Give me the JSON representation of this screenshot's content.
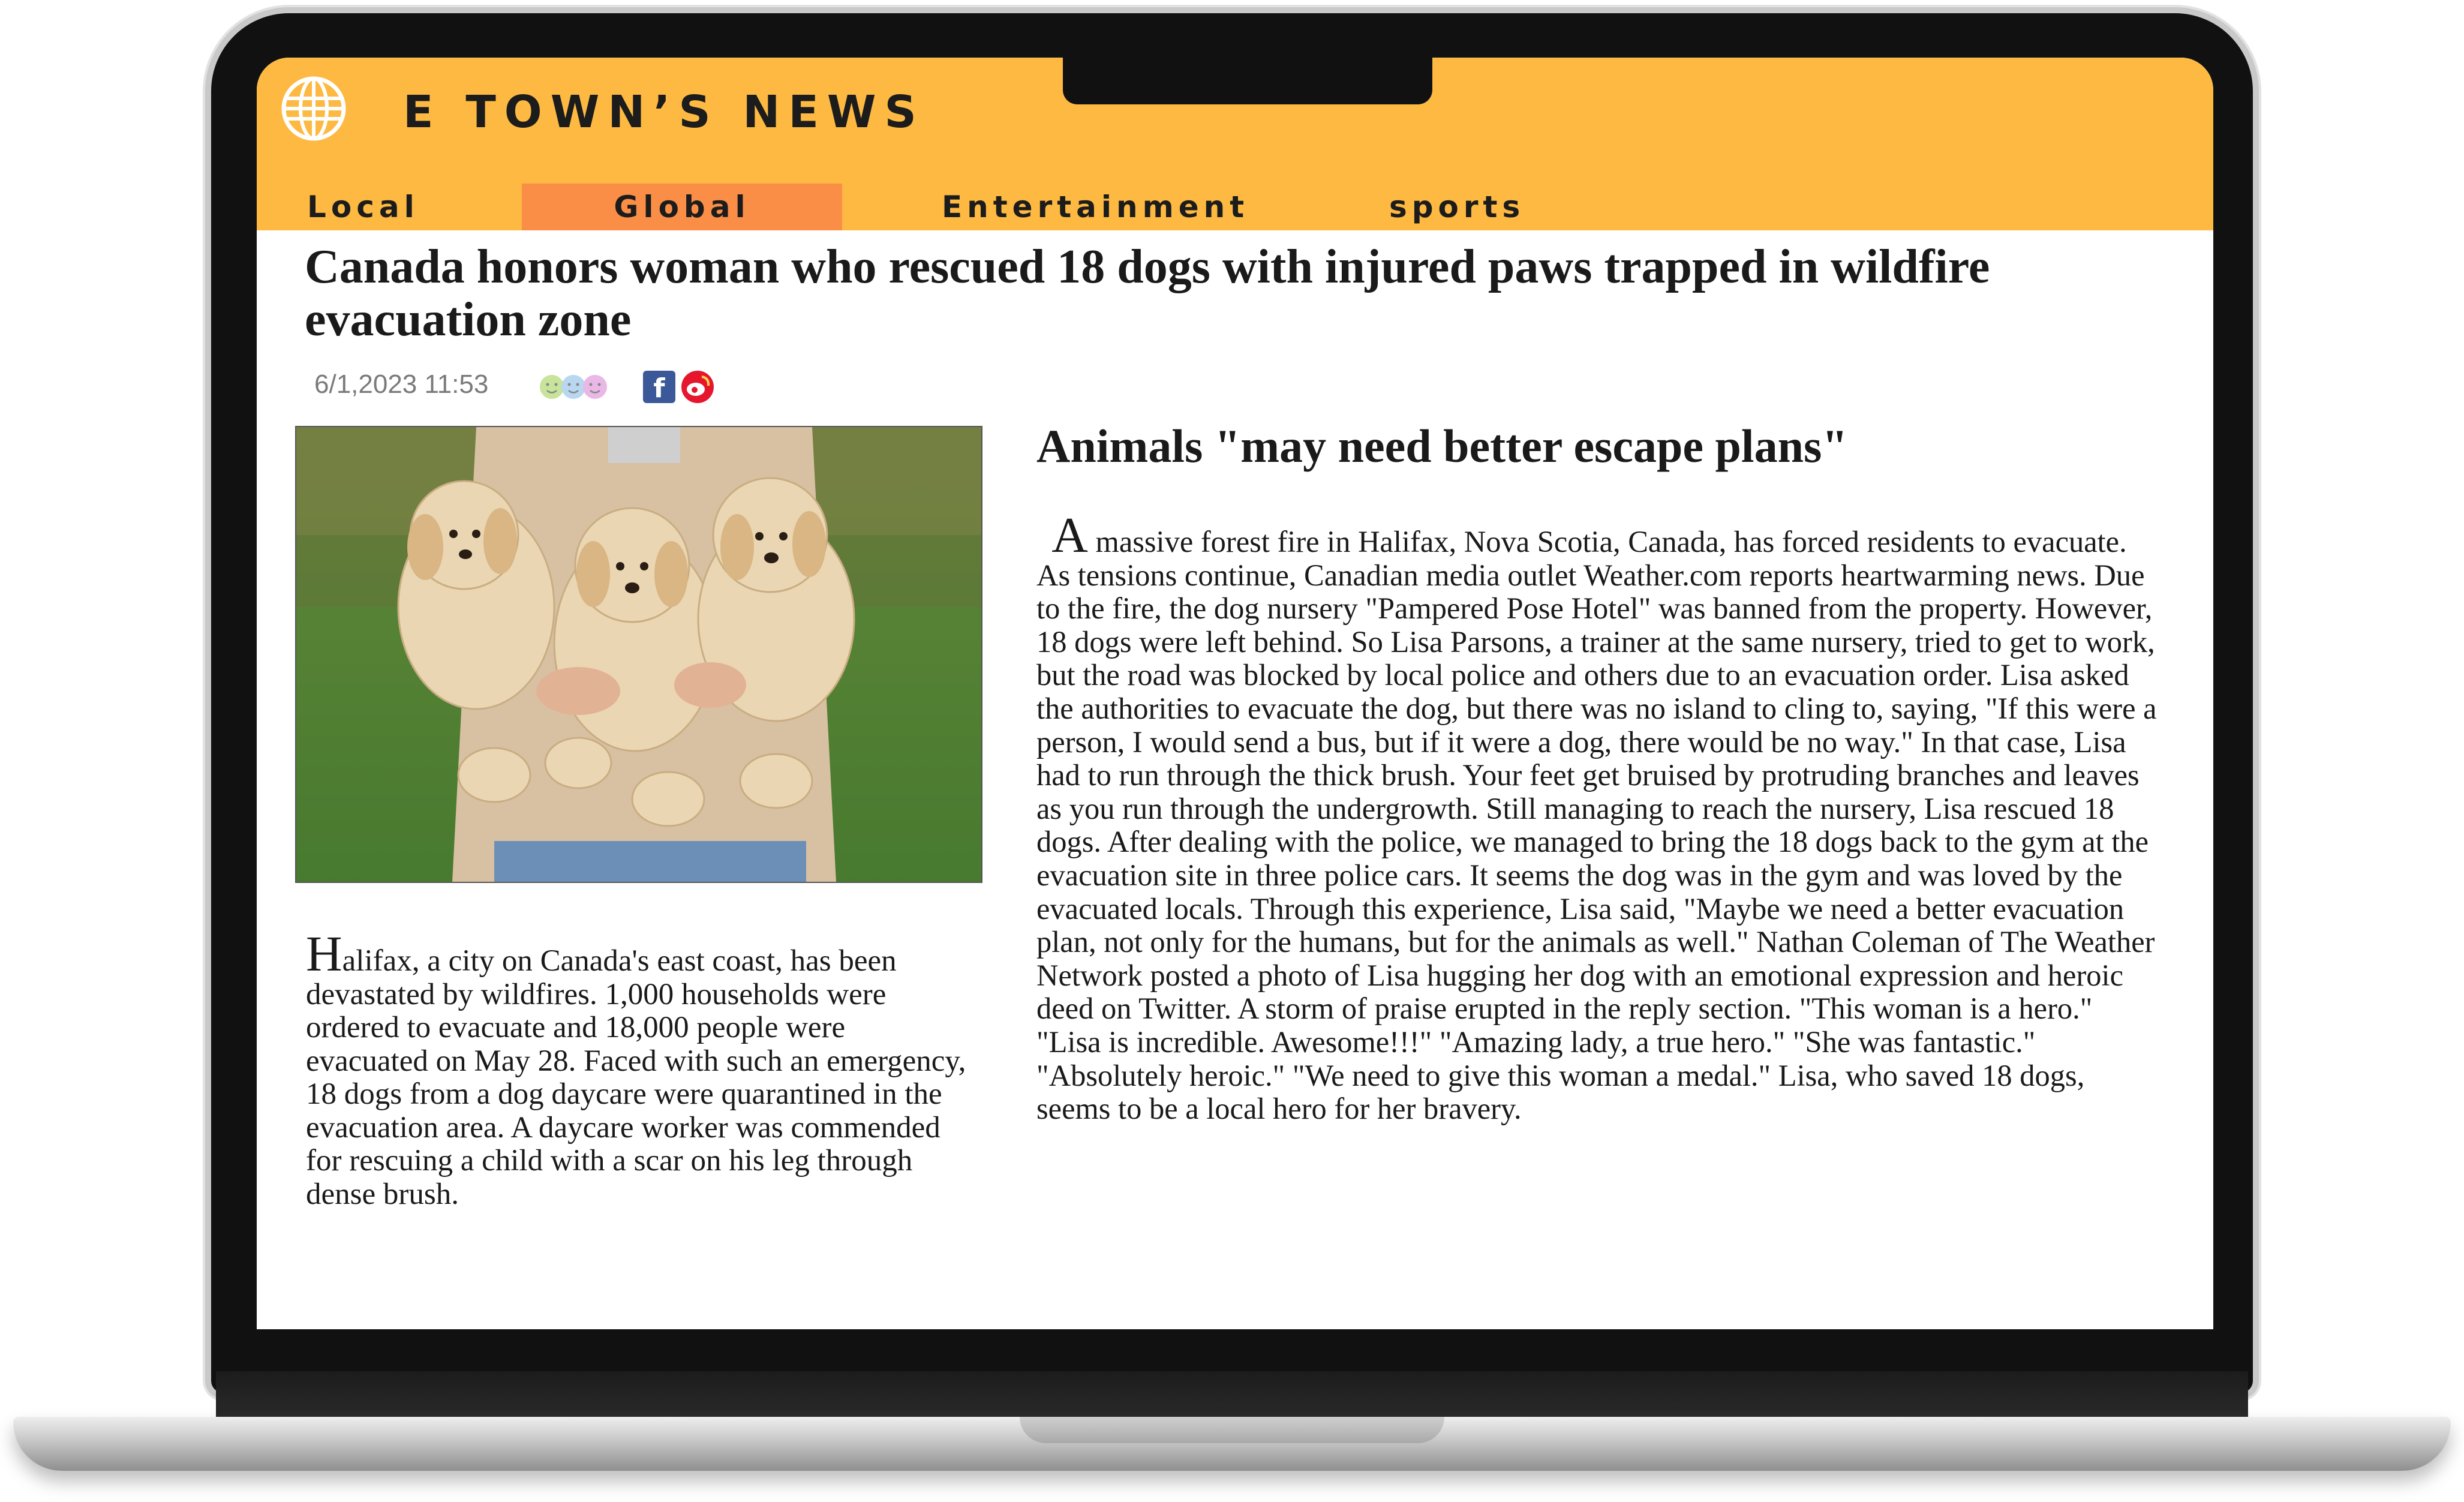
{
  "site": {
    "title": "E TOWN’S NEWS",
    "brand_color": "#fdb941",
    "active_tab_color": "#fb8e46",
    "logo_icon": "globe-icon"
  },
  "nav": {
    "tabs": [
      {
        "label": "Local"
      },
      {
        "label": "Global",
        "active": true
      },
      {
        "label": "Entertainment"
      },
      {
        "label": "sports"
      }
    ]
  },
  "article": {
    "headline": "Canada honors woman who rescued 18 dogs with injured paws trapped in wildfire evacuation zone",
    "datetime": "6/1,2023 11:53",
    "share_icons": [
      "reaction-faces-icon",
      "facebook-icon",
      "weibo-icon"
    ],
    "lead": {
      "dropcap": "H",
      "text": "alifax, a city on Canada's east coast, has been devastated by wildfires. 1,000 households were ordered to evacuate and 18,000 people were evacuated on May 28. Faced with such an emergency, 18 dogs from a dog daycare were quarantined in the evacuation area. A daycare worker was commended for rescuing a child with a scar on his leg through dense brush."
    },
    "subhead": "Animals \"may need better escape plans\"",
    "body": {
      "dropcap": "A",
      "text": " massive forest fire in Halifax, Nova Scotia, Canada, has forced residents to evacuate. As tensions continue, Canadian media outlet Weather.com reports heartwarming news. Due to the fire, the dog nursery \"Pampered Pose Hotel\" was banned from the property. However, 18 dogs were left behind. So Lisa Parsons, a trainer at the same nursery, tried to get to work, but the road was blocked by local police and others due to an evacuation order. Lisa asked the authorities to evacuate the dog, but there was no island to cling to, saying, \"If this were a person, I would send a bus, but if it were a dog, there would be no way.\" In that case, Lisa had to run through the thick brush. Your feet get bruised by protruding branches and leaves as you run through the undergrowth. Still managing to reach the nursery, Lisa rescued 18 dogs. After dealing with the police, we managed to bring the 18 dogs back to the gym at the evacuation site in three police cars. It seems the dog was in the gym and was loved by the evacuated locals. Through this experience, Lisa said, \"Maybe we need a better evacuation plan, not only for the humans, but for the animals as well.\" Nathan Coleman of The Weather Network posted a photo of Lisa hugging her dog with an emotional expression and heroic deed on Twitter. A storm of praise erupted in the reply section. \"This woman is a hero.\" \"Lisa is incredible. Awesome!!!\" \"Amazing lady, a true hero.\" \"She was fantastic.\" \"Absolutely heroic.\" \"We need to give this woman a medal.\" Lisa, who saved 18 dogs, seems to be a local hero for her bravery."
    }
  }
}
